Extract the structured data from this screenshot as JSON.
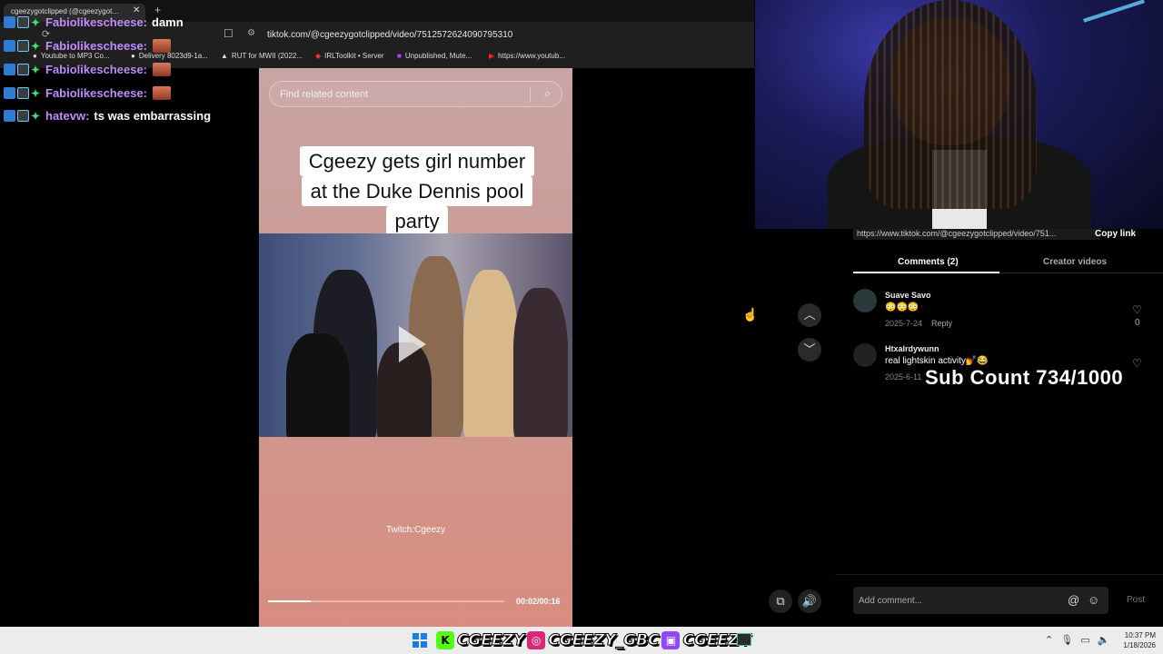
{
  "browser": {
    "tab_title": "cgeezygotclipped (@cgeezygot…",
    "url": "tiktok.com/@cgeezygotclipped/video/7512572624090795310",
    "bookmarks": [
      "Youtube to MP3 Co...",
      "Delivery 8023d9-1a...",
      "RUT for MWII (2022...",
      "IRLToolkit • Server",
      "Unpublished, Mute...",
      "https://www.youtub..."
    ]
  },
  "chat": [
    {
      "user": "Fabiolikescheese:",
      "message": "damn",
      "emote": false
    },
    {
      "user": "Fabiolikescheese:",
      "message": "",
      "emote": true
    },
    {
      "user": "Fabiolikescheese:",
      "message": "",
      "emote": true
    },
    {
      "user": "Fabiolikescheese:",
      "message": "",
      "emote": true
    },
    {
      "user": "hatevw:",
      "message": "ts was embarrassing",
      "emote": false
    }
  ],
  "video": {
    "search_placeholder": "Find related content",
    "caption_line1": "Cgeezy gets girl number",
    "caption_line2": "at the Duke Dennis pool",
    "caption_line3": "party",
    "watermark": "Twitch:Cgeezy",
    "time": "00:02/00:16",
    "progress_fraction": 0.18
  },
  "panel": {
    "share_link": "https://www.tiktok.com/@cgeezygotclipped/video/751...",
    "copy_link_label": "Copy link",
    "tab_comments": "Comments (2)",
    "tab_creator": "Creator videos",
    "comments": [
      {
        "user": "Suave Savo",
        "text": "😳😳😳",
        "date": "2025-7-24",
        "reply": "Reply",
        "likes": "0"
      },
      {
        "user": "Htxalrdywunn",
        "text": "real lightskin activity💅😂",
        "date": "2025-6-11"
      }
    ],
    "add_comment_placeholder": "Add comment...",
    "post_label": "Post"
  },
  "overlay": {
    "sub_count": "Sub Count 734/1000"
  },
  "taskbar": {
    "socials": [
      "CGEEZY",
      "CGEEZY_GBC",
      "CGEEZY"
    ],
    "time": "10:37 PM",
    "date": "1/18/2026"
  },
  "colors": {
    "chat_username": "#c28bff",
    "kick_green": "#53fc18",
    "twitch_purple": "#9146ff"
  }
}
